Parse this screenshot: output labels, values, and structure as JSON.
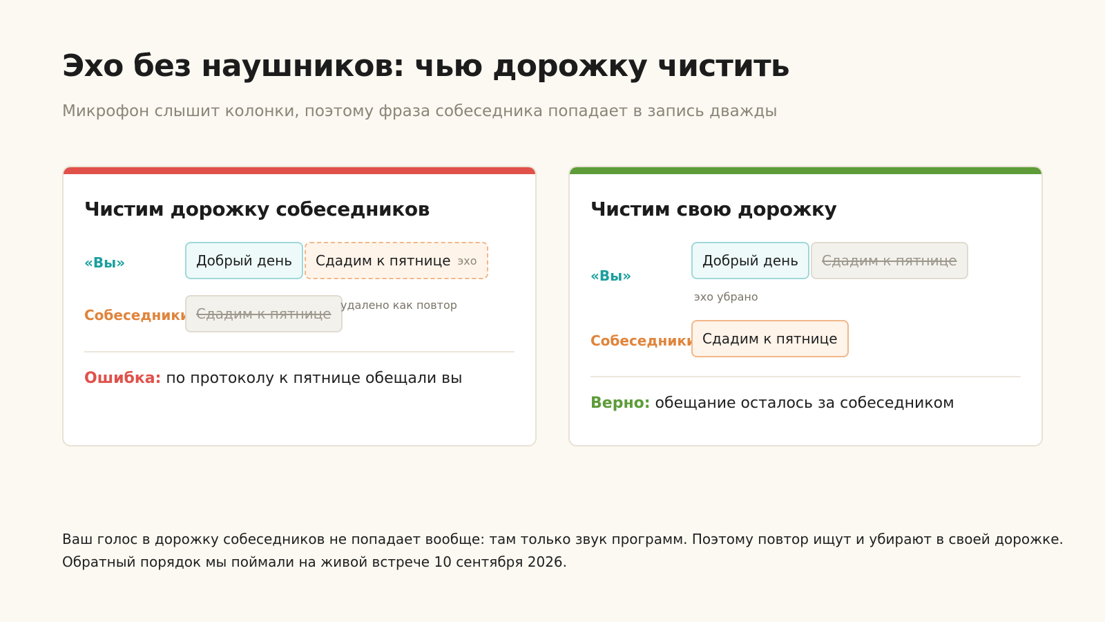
{
  "header": {
    "title": "Эхо без наушников: чью дорожку чистить",
    "subtitle": "Микрофон слышит колонки, поэтому фраза собеседника попадает в запись дважды"
  },
  "colors": {
    "wrong_accent": "#e0514a",
    "right_accent": "#5d9c39",
    "you_label": "#1b9e9e",
    "others_label": "#e0843b"
  },
  "left_card": {
    "title": "Чистим дорожку собеседников",
    "you_label": "«Вы»",
    "others_label": "Собеседники",
    "you_phrase_1": "Добрый день",
    "you_phrase_2": "Сдадим к пятнице",
    "echo_tag": "эхо",
    "others_phrase": "Сдадим к пятнице",
    "removed_note": "удалено как повтор",
    "verdict_key": "Ошибка:",
    "verdict_text": " по протоколу к пятнице обещали вы"
  },
  "right_card": {
    "title": "Чистим свою дорожку",
    "you_label": "«Вы»",
    "others_label": "Собеседники",
    "you_phrase_1": "Добрый день",
    "you_phrase_2": "Сдадим к пятнице",
    "removed_note": "эхо убрано",
    "others_phrase": "Сдадим к пятнице",
    "verdict_key": "Верно:",
    "verdict_text": " обещание осталось за собеседником"
  },
  "footer": {
    "line_1": "Ваш голос в дорожку собеседников не попадает вообще: там только звук программ. Поэтому повтор ищут и убирают в своей дорожке.",
    "line_2": "Обратный порядок мы поймали на живой встрече 10 сентября 2026."
  }
}
